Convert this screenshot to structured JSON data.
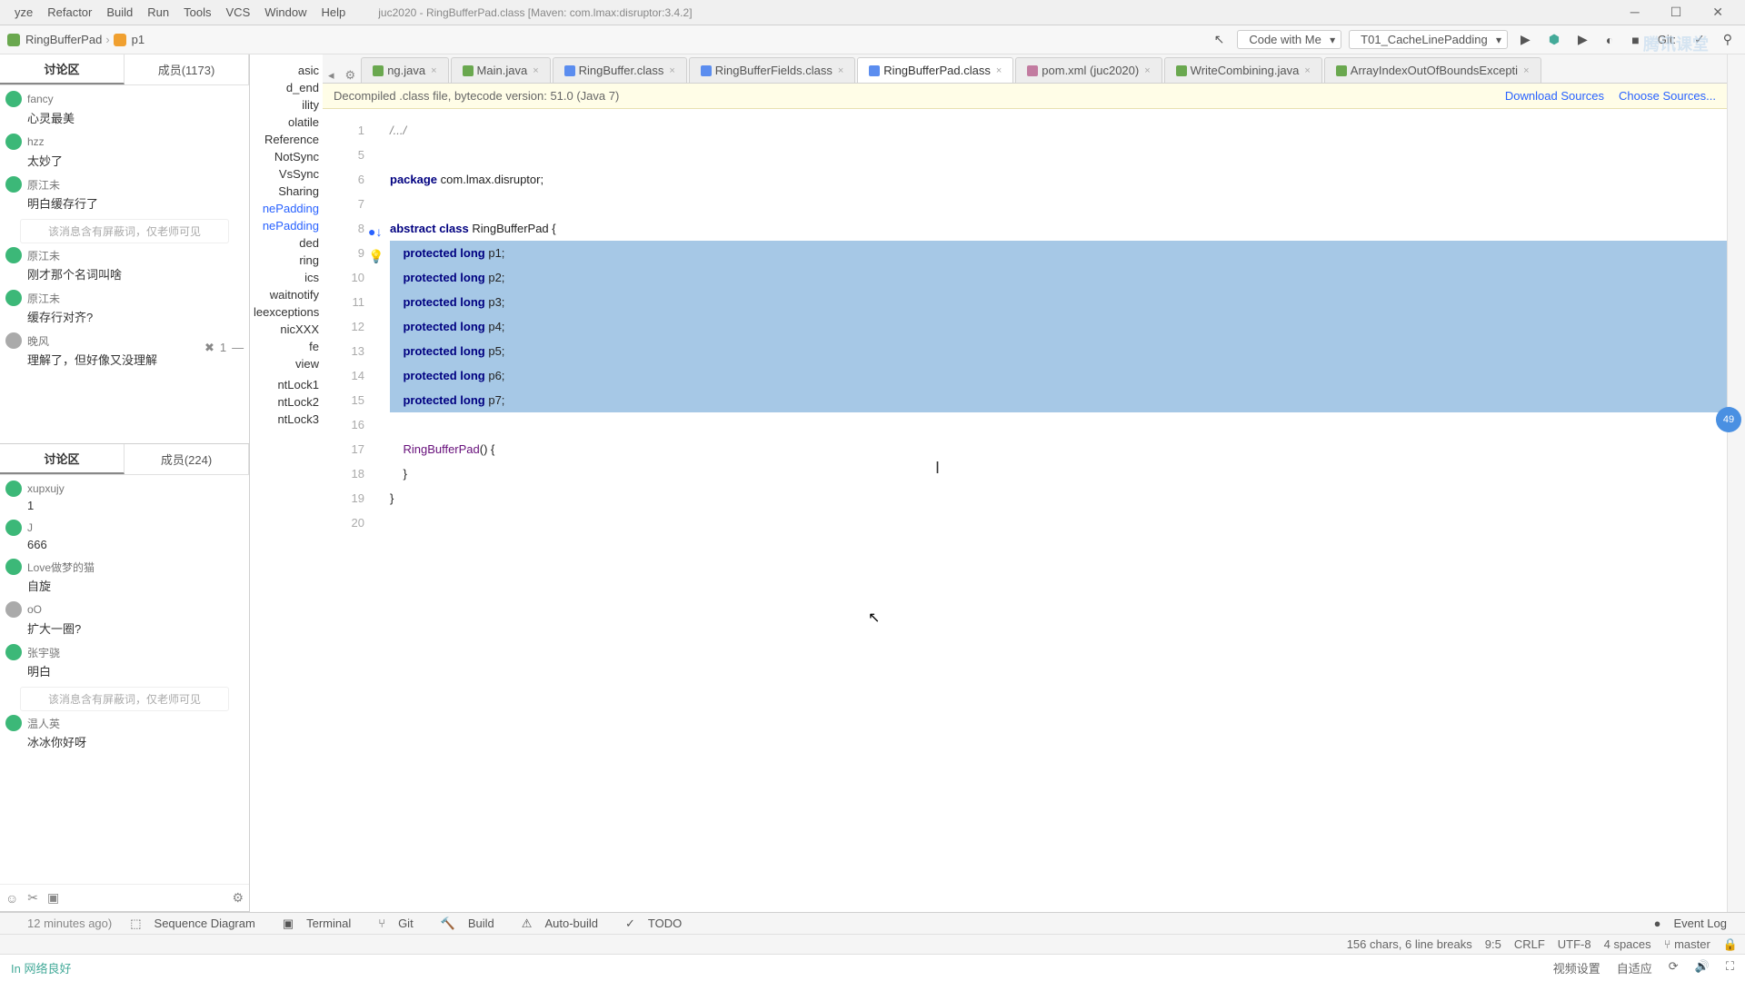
{
  "menu": {
    "yze": "yze",
    "refactor": "Refactor",
    "build": "Build",
    "run": "Run",
    "tools": "Tools",
    "vcs": "VCS",
    "window": "Window",
    "help": "Help",
    "title": "juc2020 - RingBufferPad.class [Maven: com.lmax:disruptor:3.4.2]"
  },
  "nav": {
    "crumb1": "RingBufferPad",
    "crumb2": "p1",
    "codewith": "Code with Me",
    "config": "T01_CacheLinePadding",
    "git": "Git:"
  },
  "chat1": {
    "tab1": "讨论区",
    "tab2": "成员(1173)",
    "items": [
      {
        "u": "fancy",
        "m": "心灵最美"
      },
      {
        "u": "hzz",
        "m": "太妙了"
      },
      {
        "u": "原江未",
        "m": "明白缓存行了"
      },
      {
        "u": "原江未",
        "m": "刚才那个名词叫啥"
      },
      {
        "u": "原江未",
        "m": "缓存行对齐?"
      },
      {
        "u": "晚风",
        "m": "理解了，但好像又没理解"
      }
    ],
    "sys": "该消息含有屏蔽词，仅老师可见"
  },
  "chat2": {
    "tab1": "讨论区",
    "tab2": "成员(224)",
    "items": [
      {
        "u": "xupxujy",
        "m": "1"
      },
      {
        "u": "J",
        "m": "666"
      },
      {
        "u": "Love做梦的猫",
        "m": "自旋"
      },
      {
        "u": "oO",
        "m": "扩大一圈?"
      },
      {
        "u": "张宇骁",
        "m": "明白"
      },
      {
        "u": "温人英",
        "m": "冰冰你好呀"
      }
    ],
    "sys": "该消息含有屏蔽词，仅老师可见"
  },
  "tree": [
    "asic",
    "d_end",
    "ility",
    "olatile",
    "Reference",
    "NotSync",
    "VsSync",
    "Sharing",
    "nePadding",
    "nePadding",
    "ded",
    "ring",
    "ics",
    "waitnotify",
    "leexceptions",
    "nicXXX",
    "fe",
    "view",
    "",
    "ntLock1",
    "ntLock2",
    "ntLock3"
  ],
  "tabs": [
    {
      "icon": "j",
      "label": "ng.java"
    },
    {
      "icon": "j",
      "label": "Main.java"
    },
    {
      "icon": "c",
      "label": "RingBuffer.class"
    },
    {
      "icon": "c",
      "label": "RingBufferFields.class"
    },
    {
      "icon": "c",
      "label": "RingBufferPad.class",
      "active": true
    },
    {
      "icon": "m",
      "label": "pom.xml (juc2020)"
    },
    {
      "icon": "j",
      "label": "WriteCombining.java"
    },
    {
      "icon": "j",
      "label": "ArrayIndexOutOfBoundsExcepti"
    }
  ],
  "banner": {
    "text": "Decompiled .class file, bytecode version: 51.0 (Java 7)",
    "link1": "Download Sources",
    "link2": "Choose Sources..."
  },
  "code": {
    "lines": [
      {
        "n": "1",
        "t": "/.../",
        "cls": "cm"
      },
      {
        "n": "5",
        "t": ""
      },
      {
        "n": "6",
        "t": "package com.lmax.disruptor;",
        "kw": "package"
      },
      {
        "n": "7",
        "t": ""
      },
      {
        "n": "8",
        "t": "abstract class RingBufferPad {",
        "kw": "abstract class",
        "mark": "arrow"
      },
      {
        "n": "9",
        "t": "    protected long p1;",
        "sel": true,
        "mark": "bulb"
      },
      {
        "n": "10",
        "t": "    protected long p2;",
        "sel": true
      },
      {
        "n": "11",
        "t": "    protected long p3;",
        "sel": true
      },
      {
        "n": "12",
        "t": "    protected long p4;",
        "sel": true
      },
      {
        "n": "13",
        "t": "    protected long p5;",
        "sel": true
      },
      {
        "n": "14",
        "t": "    protected long p6;",
        "sel": true
      },
      {
        "n": "15",
        "t": "    protected long p7;",
        "sel": true
      },
      {
        "n": "16",
        "t": ""
      },
      {
        "n": "17",
        "t": "    RingBufferPad() {"
      },
      {
        "n": "18",
        "t": "    }"
      },
      {
        "n": "19",
        "t": "}"
      },
      {
        "n": "20",
        "t": ""
      }
    ]
  },
  "bottom": {
    "seq": "Sequence Diagram",
    "term": "Terminal",
    "git": "Git",
    "build": "Build",
    "auto": "Auto-build",
    "todo": "TODO",
    "event": "Event Log",
    "ago": "12 minutes ago)"
  },
  "status": {
    "chars": "156 chars, 6 line breaks",
    "pos": "9:5",
    "crlf": "CRLF",
    "enc": "UTF-8",
    "spaces": "4 spaces",
    "branch": "master"
  },
  "video": {
    "net": "In 网络良好",
    "set": "视频设置",
    "auto": "自适应"
  },
  "watermark": "腾讯课堂",
  "floatnum": "49"
}
